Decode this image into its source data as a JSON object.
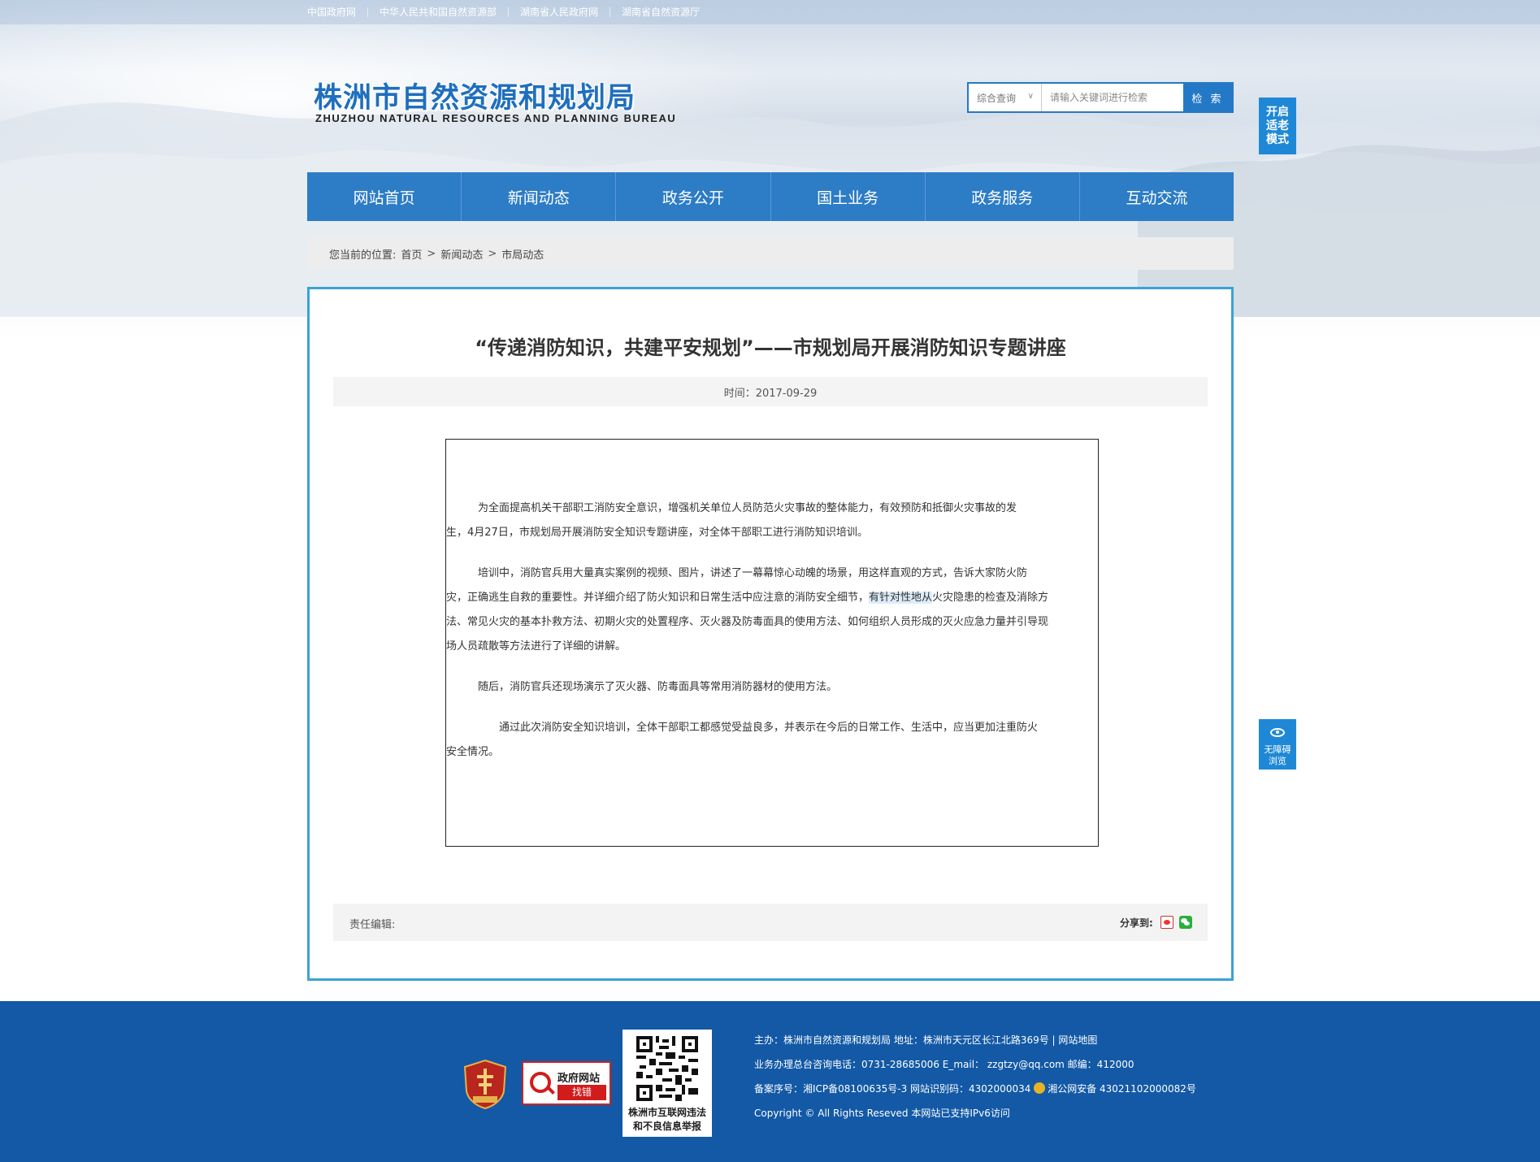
{
  "top_links": [
    "中国政府网",
    "中华人民共和国自然资源部",
    "湖南省人民政府网",
    "湖南省自然资源厅"
  ],
  "logo": {
    "cn": "株洲市自然资源和规划局",
    "en": "ZHUZHOU NATURAL RESOURCES AND PLANNING BUREAU"
  },
  "search": {
    "scope": "综合查询",
    "placeholder": "请输入关键词进行检索",
    "button": "检 索"
  },
  "elder_mode": "开启\n适老\n模式",
  "nav": [
    "网站首页",
    "新闻动态",
    "政务公开",
    "国土业务",
    "政务服务",
    "互动交流"
  ],
  "breadcrumb": {
    "label": "您当前的位置:",
    "items": [
      "首页",
      "新闻动态",
      "市局动态"
    ],
    "sep": ">"
  },
  "article": {
    "title": "“传递消防知识，共建平安规划”——市规划局开展消防知识专题讲座",
    "date": "时间：2017-09-29",
    "paragraphs": {
      "p1_l1": "　　　为全面提高机关干部职工消防安全意识，增强机关单位人员防范火灾事故的整体能力，有效预防和抵御火灾事故的发",
      "p1_l2": "生，4月27日，市规划局开展消防安全知识专题讲座，对全体干部职工进行消防知识培训。",
      "p2_l1": "　　　培训中，消防官兵用大量真实案例的视频、图片，讲述了一幕幕惊心动魄的场景，用这样直观的方式，告诉大家防火防",
      "p2_l2a": "灾，正确逃生自救的重要性。并详细介绍了防火知识和日常生活中应注意的消防安全细节，",
      "p2_l2b": "有针对性地从",
      "p2_l2c": "火灾隐患的检查及消除方",
      "p2_l3": "法、常见火灾的基本扑救方法、初期火灾的处置程序、灭火器及防毒面具的使用方法、如何组织人员形成的灭火应急力量并引导现",
      "p2_l4": "场人员疏散等方法进行了详细的讲解。",
      "p3": "　　　随后，消防官兵还现场演示了灭火器、防毒面具等常用消防器材的使用方法。",
      "p4_l1": "　　　　　通过此次消防安全知识培训，全体干部职工都感觉受益良多，并表示在今后的日常工作、生活中，应当更加注重防火",
      "p4_l2": "安全情况。"
    },
    "editor_label": "责任编辑:",
    "share_label": "分享到:"
  },
  "accessible": {
    "line1": "无障碍",
    "line2": "浏览"
  },
  "footer": {
    "govsite_top": "政府网站",
    "govsite_bottom": "找错",
    "qr_line1": "株洲市互联网违法",
    "qr_line2": "和不良信息举报",
    "line1": "主办：株洲市自然资源和规划局  地址：株洲市天元区长江北路369号  |  网站地图",
    "line2": "业务办理总台咨询电话：0731-28685006    E_mail：   zzgtzy@qq.com     邮编：412000",
    "line3a": "备案序号：湘ICP备08100635号-3 网站识别码：4302000034  ",
    "line3b": "湘公网安备 43021102000082号",
    "line4": "Copyright © All Rights Reseved 本网站已支持IPv6访问"
  },
  "icons": {
    "search_scope": "chevron-down-icon",
    "share1": "weibo-icon",
    "share2": "wechat-icon",
    "accessible": "eye-icon",
    "police": "police-badge-icon",
    "party": "party-emblem-icon",
    "govsite": "magnifier-icon"
  },
  "colors": {
    "nav": "#2c7cc6",
    "accent": "#2479c6",
    "content_border": "#3aa3d6",
    "footer": "#1359a6",
    "side_button": "#1f88d6"
  }
}
